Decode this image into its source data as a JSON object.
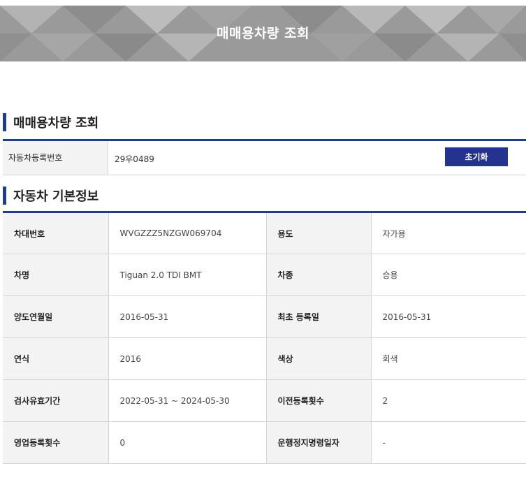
{
  "banner": {
    "title": "매매용차량 조회"
  },
  "search_section": {
    "title": "매매용차량 조회",
    "reg_number_label": "자동차등록번호",
    "reg_number_value": "29우0489",
    "reset_label": "초기화"
  },
  "info_section": {
    "title": "자동차 기본정보",
    "rows": [
      [
        {
          "label": "차대번호",
          "value": "WVGZZZ5NZGW069704"
        },
        {
          "label": "용도",
          "value": "자가용"
        }
      ],
      [
        {
          "label": "차명",
          "value": "Tiguan 2.0 TDI BMT"
        },
        {
          "label": "차종",
          "value": "승용"
        }
      ],
      [
        {
          "label": "양도연월일",
          "value": "2016-05-31"
        },
        {
          "label": "최초 등록일",
          "value": "2016-05-31"
        }
      ],
      [
        {
          "label": "연식",
          "value": "2016"
        },
        {
          "label": "색상",
          "value": "회색"
        }
      ],
      [
        {
          "label": "검사유효기간",
          "value": "2022-05-31 ~ 2024-05-30"
        },
        {
          "label": "이전등록횟수",
          "value": "2"
        }
      ],
      [
        {
          "label": "영업등록횟수",
          "value": "0"
        },
        {
          "label": "운행정지명령일자",
          "value": "-"
        }
      ]
    ]
  },
  "colors": {
    "accent": "#1f3d8a",
    "button": "#24348e",
    "label_bg": "#f3f3f3",
    "banner_bg": "#9a9a9a"
  }
}
